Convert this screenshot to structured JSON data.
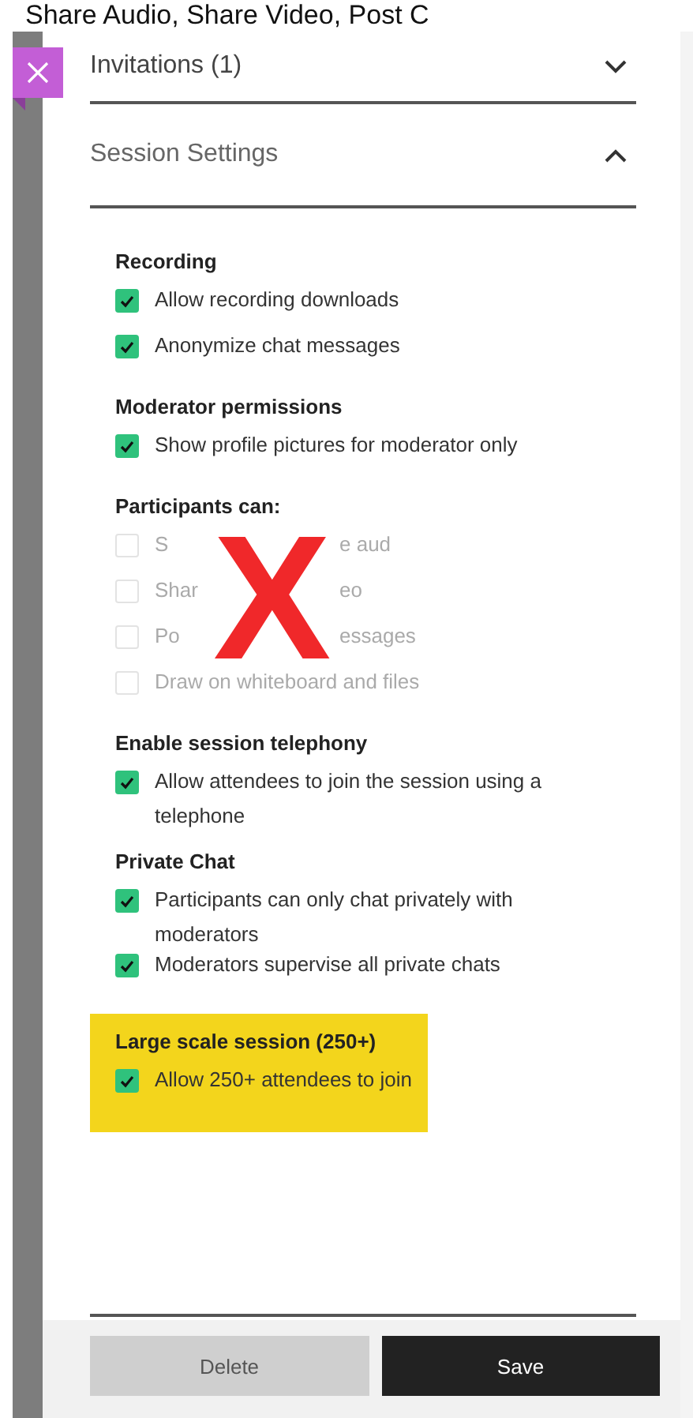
{
  "caption": "Share Audio, Share Video, Post C",
  "accordions": [
    {
      "title": "Invitations (1)",
      "expanded": false
    },
    {
      "title": "Session Settings",
      "expanded": true
    }
  ],
  "sections": [
    {
      "title": "Recording",
      "highlighted": false,
      "items": [
        {
          "label": "Allow recording downloads",
          "checked": true,
          "disabled": false
        },
        {
          "label": "Anonymize chat messages",
          "checked": true,
          "disabled": false
        }
      ]
    },
    {
      "title": "Moderator permissions",
      "highlighted": false,
      "items": [
        {
          "label": "Show profile pictures for moderator only",
          "checked": true,
          "disabled": false
        }
      ]
    },
    {
      "title": "Participants can:",
      "highlighted": false,
      "annotation": "X",
      "items": [
        {
          "label_parts": [
            "S",
            "e aud"
          ],
          "checked": false,
          "disabled": true
        },
        {
          "label_parts": [
            "Shar",
            "eo"
          ],
          "checked": false,
          "disabled": true
        },
        {
          "label_parts": [
            "Po",
            "essages"
          ],
          "checked": false,
          "disabled": true
        },
        {
          "label": "Draw on whiteboard and files",
          "checked": false,
          "disabled": true
        }
      ]
    },
    {
      "title": "Enable session telephony",
      "highlighted": false,
      "items": [
        {
          "label": "Allow attendees to join the session using a telephone",
          "checked": true,
          "disabled": false
        }
      ]
    },
    {
      "title": "Private Chat",
      "highlighted": false,
      "items": [
        {
          "label": "Participants can only chat privately with moderators",
          "checked": true,
          "disabled": false
        },
        {
          "label": "Moderators supervise all private chats",
          "checked": true,
          "disabled": false
        }
      ]
    },
    {
      "title": "Large scale session (250+)",
      "highlighted": true,
      "items": [
        {
          "label": "Allow 250+ attendees to join",
          "checked": true,
          "disabled": false
        }
      ]
    }
  ],
  "buttons": [
    {
      "label": "Delete",
      "kind": "secondary"
    },
    {
      "label": "Save",
      "kind": "primary"
    }
  ]
}
